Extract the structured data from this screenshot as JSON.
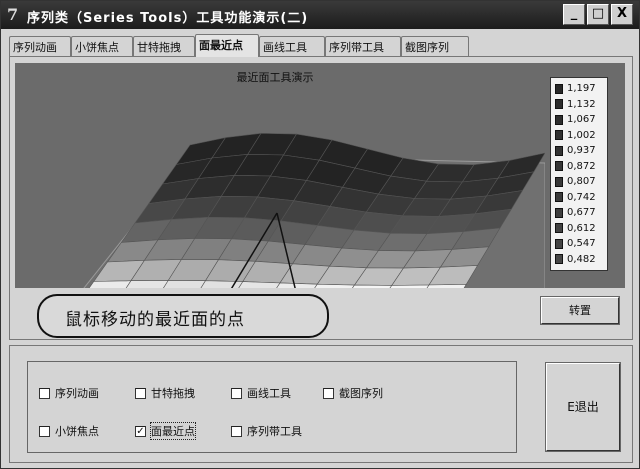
{
  "window": {
    "title": "序列类（Series Tools）工具功能演示(二)",
    "controls": {
      "minimize": "_",
      "maximize": "□",
      "close": "X"
    }
  },
  "tabs": [
    {
      "label": "序列动画",
      "active": false
    },
    {
      "label": "小饼焦点",
      "active": false
    },
    {
      "label": "甘特拖拽",
      "active": false
    },
    {
      "label": "面最近点",
      "active": true
    },
    {
      "label": "画线工具",
      "active": false
    },
    {
      "label": "序列带工具",
      "active": false
    },
    {
      "label": "截图序列",
      "active": false
    }
  ],
  "chart_data": {
    "type": "surface",
    "title": "最近面工具演示",
    "legend_values": [
      "1,197",
      "1,132",
      "1,067",
      "1,002",
      "0,937",
      "0,872",
      "0,807",
      "0,742",
      "0,677",
      "0,612",
      "0,547",
      "0,482"
    ],
    "legend_placement": "right",
    "colors": {
      "surface_dark": "#2e2e2e",
      "surface_light": "#f2f2f2",
      "background": "#6b6b6b"
    }
  },
  "callout": {
    "text": "鼠标移动的最近面的点"
  },
  "buttons": {
    "transpose": "转置",
    "exit": "E退出"
  },
  "checkboxes": [
    {
      "label": "序列动画",
      "checked": false,
      "focused": false
    },
    {
      "label": "甘特拖拽",
      "checked": false,
      "focused": false
    },
    {
      "label": "画线工具",
      "checked": false,
      "focused": false
    },
    {
      "label": "截图序列",
      "checked": false,
      "focused": false
    },
    {
      "label": "小饼焦点",
      "checked": false,
      "focused": false
    },
    {
      "label": "面最近点",
      "checked": true,
      "focused": true
    },
    {
      "label": "序列带工具",
      "checked": false,
      "focused": false
    }
  ]
}
